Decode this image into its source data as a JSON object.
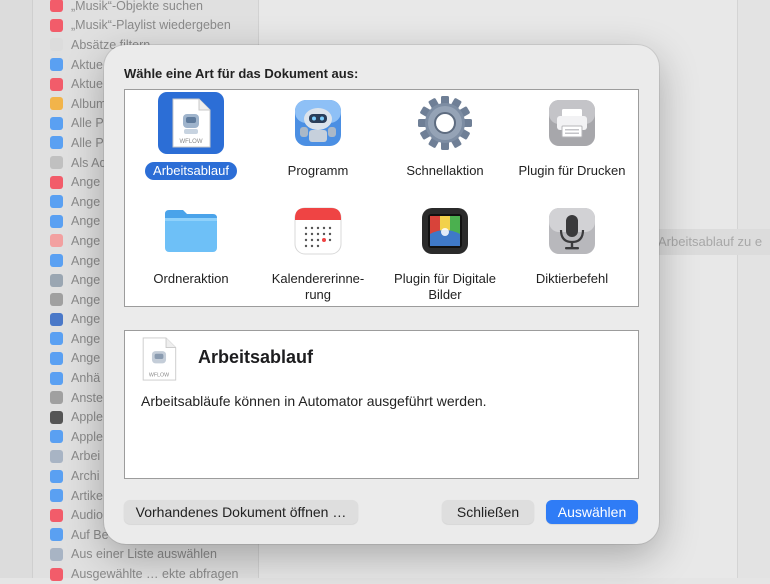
{
  "background": {
    "sidebar_items": [
      {
        "label": "„Musik“-Objekte suchen",
        "color": "#f25c6a"
      },
      {
        "label": "„Musik“-Playlist wiedergeben",
        "color": "#f25c6a"
      },
      {
        "label": "Absätze filtern",
        "color": "#dcdcdc"
      },
      {
        "label": "Aktue",
        "color": "#5aa0f2"
      },
      {
        "label": "Aktue",
        "color": "#f25c6a"
      },
      {
        "label": "Album",
        "color": "#f2b44a"
      },
      {
        "label": "Alle P",
        "color": "#5aa0f2"
      },
      {
        "label": "Alle P",
        "color": "#5aa0f2"
      },
      {
        "label": "Als Ad",
        "color": "#c0c0c0"
      },
      {
        "label": "Ange",
        "color": "#f25c6a"
      },
      {
        "label": "Ange",
        "color": "#5aa0f2"
      },
      {
        "label": "Ange",
        "color": "#5aa0f2"
      },
      {
        "label": "Ange",
        "color": "#f2a0a0"
      },
      {
        "label": "Ange",
        "color": "#5aa0f2"
      },
      {
        "label": "Ange",
        "color": "#9aa6b2"
      },
      {
        "label": "Ange",
        "color": "#a0a0a0"
      },
      {
        "label": "Ange",
        "color": "#4a78c8"
      },
      {
        "label": "Ange",
        "color": "#5aa0f2"
      },
      {
        "label": "Ange",
        "color": "#5aa0f2"
      },
      {
        "label": "Anhä",
        "color": "#5aa0f2"
      },
      {
        "label": "Anste",
        "color": "#a0a0a0"
      },
      {
        "label": "Apple",
        "color": "#555555"
      },
      {
        "label": "Apple",
        "color": "#5aa0f2"
      },
      {
        "label": "Arbei",
        "color": "#a8b4c4"
      },
      {
        "label": "Archi",
        "color": "#5aa0f2"
      },
      {
        "label": "Artike",
        "color": "#5aa0f2"
      },
      {
        "label": "Audio",
        "color": "#f25c6a"
      },
      {
        "label": "Auf Be",
        "color": "#5aa0f2"
      },
      {
        "label": "Aus einer Liste auswählen",
        "color": "#a8b4c4"
      },
      {
        "label": "Ausgewählte … ekte abfragen",
        "color": "#f25c6a"
      }
    ],
    "drop_hint": "Arbeitsablauf zu e"
  },
  "dialog": {
    "prompt": "Wähle eine Art für das Dokument aus:",
    "types": [
      {
        "label": "Arbeitsablauf",
        "icon": "workflow-document-icon",
        "selected": true
      },
      {
        "label": "Programm",
        "icon": "automator-robot-icon",
        "selected": false
      },
      {
        "label": "Schnellaktion",
        "icon": "gear-icon",
        "selected": false
      },
      {
        "label": "Plugin für Drucken",
        "icon": "printer-icon",
        "selected": false
      },
      {
        "label": "Ordneraktion",
        "icon": "folder-icon",
        "selected": false
      },
      {
        "label": "Kalendererinne-rung",
        "icon": "calendar-icon",
        "selected": false
      },
      {
        "label": "Plugin für Digitale Bilder",
        "icon": "image-capture-icon",
        "selected": false
      },
      {
        "label": "Diktierbefehl",
        "icon": "microphone-icon",
        "selected": false
      }
    ],
    "icon_doc_label": "WFLOW",
    "description": {
      "title": "Arbeitsablauf",
      "text": "Arbeitsabläufe können in Automator ausgeführt werden."
    },
    "buttons": {
      "open_existing": "Vorhandenes Dokument öffnen …",
      "close": "Schließen",
      "choose": "Auswählen"
    },
    "colors": {
      "accent": "#2f7cf6",
      "selection": "#2c6ed6"
    }
  }
}
